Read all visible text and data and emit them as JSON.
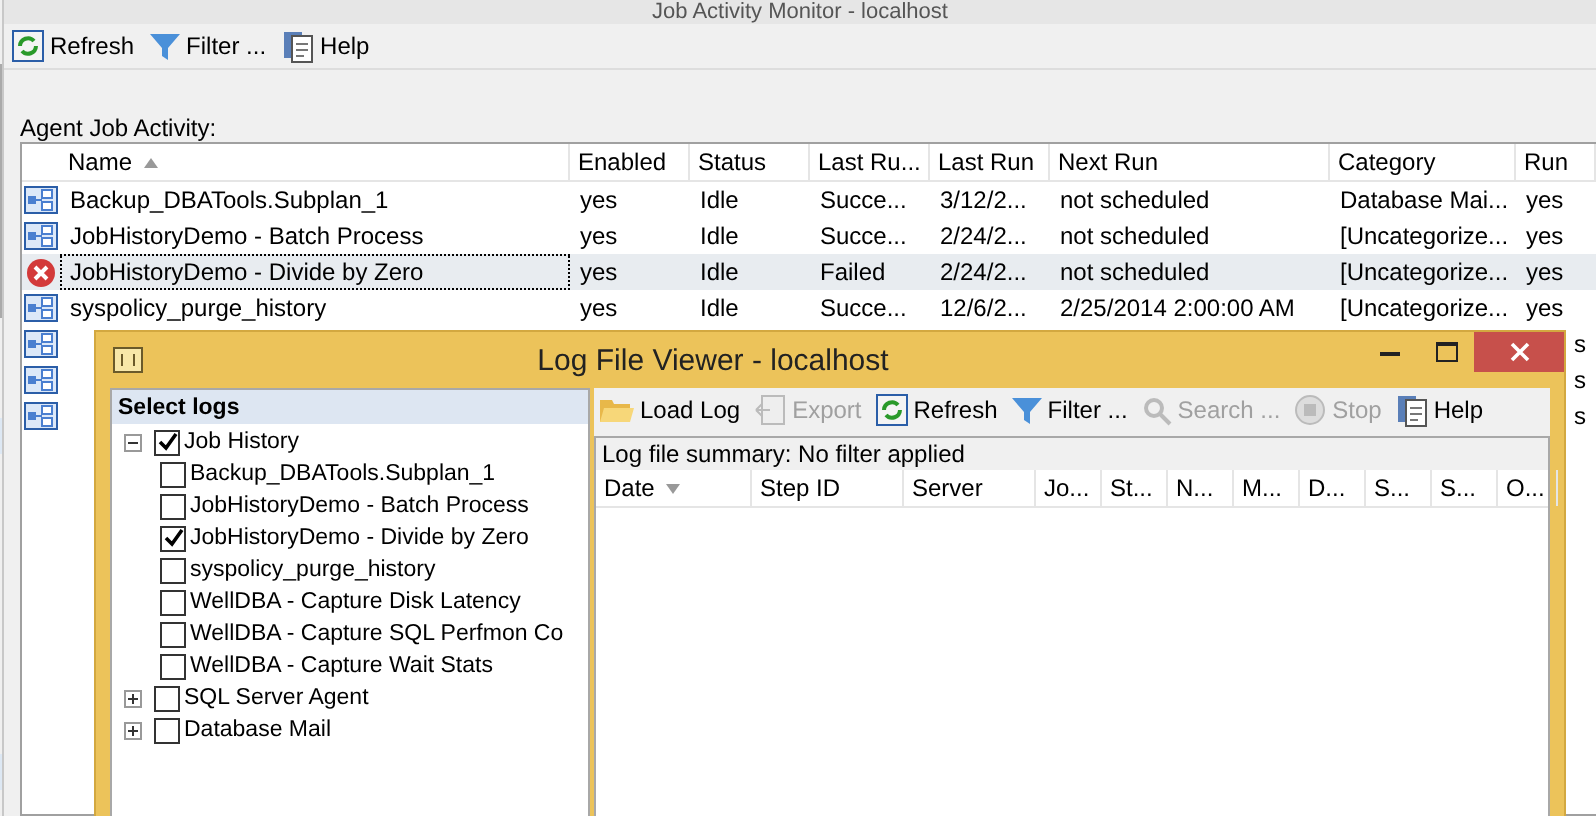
{
  "background_window": {
    "title": "Job Activity Monitor - localhost",
    "toolbar": [
      {
        "label": "Refresh",
        "disabled": false
      },
      {
        "label": "Filter ...",
        "disabled": false
      },
      {
        "label": "Help",
        "disabled": false
      }
    ],
    "section_label": "Agent Job Activity:",
    "table": {
      "columns": [
        {
          "label": "Name",
          "sorted": true
        },
        {
          "label": "Enabled"
        },
        {
          "label": "Status"
        },
        {
          "label": "Last Ru..."
        },
        {
          "label": "Last Run"
        },
        {
          "label": "Next Run"
        },
        {
          "label": "Category"
        },
        {
          "label": "Run"
        }
      ],
      "rows": [
        {
          "kind": "job",
          "selected": false,
          "cells": [
            "Backup_DBATools.Subplan_1",
            "yes",
            "Idle",
            "Succe...",
            "3/12/2...",
            "not scheduled",
            "Database Mai...",
            "yes"
          ]
        },
        {
          "kind": "job",
          "selected": false,
          "cells": [
            "JobHistoryDemo - Batch Process",
            "yes",
            "Idle",
            "Succe...",
            "2/24/2...",
            "not scheduled",
            "[Uncategorize...",
            "yes"
          ]
        },
        {
          "kind": "failed",
          "selected": true,
          "cells": [
            "JobHistoryDemo - Divide by Zero",
            "yes",
            "Idle",
            "Failed",
            "2/24/2...",
            "not scheduled",
            "[Uncategorize...",
            "yes"
          ]
        },
        {
          "kind": "job",
          "selected": false,
          "cells": [
            "syspolicy_purge_history",
            "yes",
            "Idle",
            "Succe...",
            "12/6/2...",
            "2/25/2014 2:00:00 AM",
            "[Uncategorize...",
            "yes"
          ]
        },
        {
          "kind": "job",
          "selected": false,
          "tail": "s"
        },
        {
          "kind": "job",
          "selected": false,
          "tail": "s"
        },
        {
          "kind": "job",
          "selected": false,
          "tail": "s"
        }
      ]
    }
  },
  "log_viewer": {
    "title": "Log File Viewer - localhost",
    "select_logs_title": "Select logs",
    "tree": [
      {
        "label": "Job History",
        "checked": true,
        "expanded": true,
        "children": [
          {
            "label": "Backup_DBATools.Subplan_1",
            "checked": false
          },
          {
            "label": "JobHistoryDemo - Batch Process",
            "checked": false
          },
          {
            "label": "JobHistoryDemo - Divide by Zero",
            "checked": true
          },
          {
            "label": "syspolicy_purge_history",
            "checked": false
          },
          {
            "label": "WellDBA - Capture Disk Latency",
            "checked": false
          },
          {
            "label": "WellDBA - Capture SQL Perfmon Co",
            "checked": false
          },
          {
            "label": "WellDBA - Capture Wait Stats",
            "checked": false
          }
        ]
      },
      {
        "label": "SQL Server Agent",
        "checked": false,
        "expanded": false
      },
      {
        "label": "Database Mail",
        "checked": false,
        "expanded": false
      }
    ],
    "toolbar": [
      {
        "label": "Load Log",
        "disabled": false
      },
      {
        "label": "Export",
        "disabled": true
      },
      {
        "label": "Refresh",
        "disabled": false
      },
      {
        "label": "Filter ...",
        "disabled": false
      },
      {
        "label": "Search ...",
        "disabled": true
      },
      {
        "label": "Stop",
        "disabled": true
      },
      {
        "label": "Help",
        "disabled": false
      }
    ],
    "summary": "Log file summary: No filter applied",
    "columns": [
      {
        "label": "Date",
        "sorted": true
      },
      {
        "label": "Step ID"
      },
      {
        "label": "Server"
      },
      {
        "label": "Jo..."
      },
      {
        "label": "St..."
      },
      {
        "label": "N..."
      },
      {
        "label": "M..."
      },
      {
        "label": "D..."
      },
      {
        "label": "S..."
      },
      {
        "label": "S..."
      },
      {
        "label": "O..."
      }
    ]
  }
}
